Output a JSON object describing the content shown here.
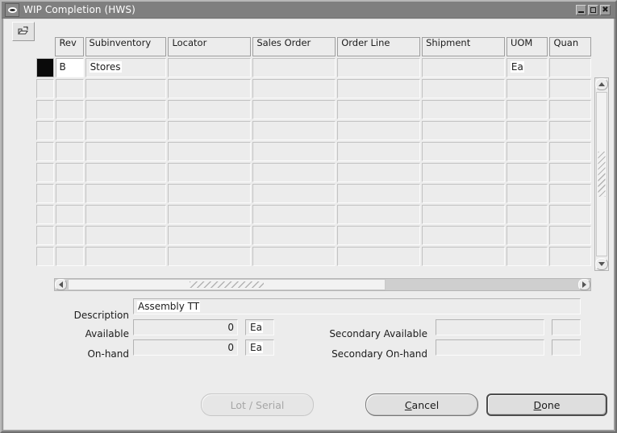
{
  "window": {
    "title": "WIP Completion (HWS)",
    "sys_icon": "oval-system-icon",
    "controls": {
      "minimize": "minimize-icon",
      "maximize": "maximize-icon",
      "close": "close-icon"
    }
  },
  "toolbar": {
    "edit_button_icon": "editor-open-icon"
  },
  "grid": {
    "columns": [
      {
        "label": "Rev",
        "width": 36
      },
      {
        "label": "Subinventory",
        "width": 104
      },
      {
        "label": "Locator",
        "width": 106
      },
      {
        "label": "Sales Order",
        "width": 106
      },
      {
        "label": "Order Line",
        "width": 106
      },
      {
        "label": "Shipment",
        "width": 106
      },
      {
        "label": "UOM",
        "width": 53
      },
      {
        "label": "Quan",
        "width": 53
      }
    ],
    "rows": [
      {
        "selected": true,
        "rev": "B",
        "subinventory": "Stores",
        "locator": "",
        "sales_order": "",
        "order_line": "",
        "shipment": "",
        "uom": "Ea",
        "quantity": ""
      },
      {
        "selected": false,
        "rev": "",
        "subinventory": "",
        "locator": "",
        "sales_order": "",
        "order_line": "",
        "shipment": "",
        "uom": "",
        "quantity": ""
      },
      {
        "selected": false,
        "rev": "",
        "subinventory": "",
        "locator": "",
        "sales_order": "",
        "order_line": "",
        "shipment": "",
        "uom": "",
        "quantity": ""
      },
      {
        "selected": false,
        "rev": "",
        "subinventory": "",
        "locator": "",
        "sales_order": "",
        "order_line": "",
        "shipment": "",
        "uom": "",
        "quantity": ""
      },
      {
        "selected": false,
        "rev": "",
        "subinventory": "",
        "locator": "",
        "sales_order": "",
        "order_line": "",
        "shipment": "",
        "uom": "",
        "quantity": ""
      },
      {
        "selected": false,
        "rev": "",
        "subinventory": "",
        "locator": "",
        "sales_order": "",
        "order_line": "",
        "shipment": "",
        "uom": "",
        "quantity": ""
      },
      {
        "selected": false,
        "rev": "",
        "subinventory": "",
        "locator": "",
        "sales_order": "",
        "order_line": "",
        "shipment": "",
        "uom": "",
        "quantity": ""
      },
      {
        "selected": false,
        "rev": "",
        "subinventory": "",
        "locator": "",
        "sales_order": "",
        "order_line": "",
        "shipment": "",
        "uom": "",
        "quantity": ""
      },
      {
        "selected": false,
        "rev": "",
        "subinventory": "",
        "locator": "",
        "sales_order": "",
        "order_line": "",
        "shipment": "",
        "uom": "",
        "quantity": ""
      },
      {
        "selected": false,
        "rev": "",
        "subinventory": "",
        "locator": "",
        "sales_order": "",
        "order_line": "",
        "shipment": "",
        "uom": "",
        "quantity": ""
      }
    ]
  },
  "detail": {
    "description_label": "Description",
    "description_value": "Assembly TT",
    "available_label": "Available",
    "available_value": "0",
    "available_uom": "Ea",
    "onhand_label": "On-hand",
    "onhand_value": "0",
    "onhand_uom": "Ea",
    "secondary_available_label": "Secondary Available",
    "secondary_available_value": "",
    "secondary_available_uom": "",
    "secondary_onhand_label": "Secondary On-hand",
    "secondary_onhand_value": "",
    "secondary_onhand_uom": ""
  },
  "buttons": {
    "lot_serial": "Lot / Serial",
    "cancel_pre": "C",
    "cancel_post": "ancel",
    "done_pre": "D",
    "done_post": "one"
  }
}
